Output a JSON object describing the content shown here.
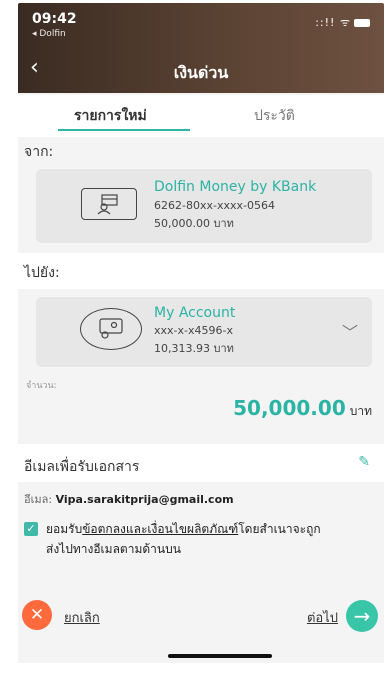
{
  "status": {
    "time": "09:42",
    "back_app": "◂ Dolfin",
    "signal": "::!! ᯤ"
  },
  "header": {
    "back_icon": "‹",
    "title": "เงินด่วน"
  },
  "tabs": [
    {
      "label": "รายการใหม่",
      "active": true
    },
    {
      "label": "ประวัติ",
      "active": false
    }
  ],
  "from": {
    "label": "จาก:",
    "name": "Dolfin Money by KBank",
    "account": "6262-80xx-xxxx-0564",
    "balance": "50,000.00 บาท"
  },
  "to": {
    "label": "ไปยัง:",
    "name": "My Account",
    "account": "xxx-x-x4596-x",
    "balance": "10,313.93 บาท",
    "chevron": "﹀"
  },
  "amount": {
    "label": "จำนวน:",
    "value": "50,000.00",
    "unit": "บาท"
  },
  "email": {
    "title": "อีเมลเพื่อรับเอกสาร",
    "edit_icon": "✎",
    "prefix": "อีเมล:",
    "value": "Vipa.sarakitprija@gmail.com"
  },
  "consent": {
    "check_mark": "✓",
    "pre": "ยอมรับ",
    "link": "ข้อตกลงและเงื่อนไขผลิตภัณฑ์",
    "post": "โดยสำเนาจะถูก",
    "line2": "ส่งไปทางอีเมลตามด้านบน"
  },
  "actions": {
    "cancel_icon": "✕",
    "cancel_label": "ยกเลิก",
    "next_label": "ต่อไป",
    "next_icon": "→"
  },
  "colors": {
    "accent": "#2bb3a3",
    "cancel": "#ff6a3d",
    "next": "#39c5a8",
    "header": "#5a4233"
  }
}
